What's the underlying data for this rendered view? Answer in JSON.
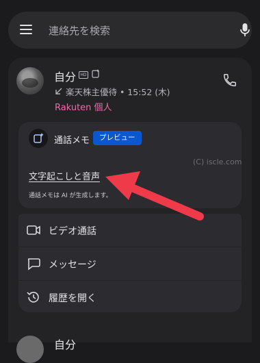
{
  "search": {
    "placeholder": "連絡先を検索"
  },
  "contact": {
    "name": "自分",
    "hd_badge": "HD",
    "call_info": "楽天株主優待 • 15:52 (木)",
    "labels": "Rakuten 個人"
  },
  "memo": {
    "title": "通話メモ",
    "badge": "プレビュー",
    "watermark": "(C) iscle.com",
    "transcript_link": "文字起こしと音声",
    "ai_note": "通話メモは AI が生成します。"
  },
  "actions": [
    {
      "label": "ビデオ通話",
      "icon": "video-icon"
    },
    {
      "label": "メッセージ",
      "icon": "message-icon"
    },
    {
      "label": "履歴を開く",
      "icon": "history-icon"
    }
  ],
  "next_contact": {
    "name": "自分"
  },
  "colors": {
    "background": "#1b1b1d",
    "surface": "#232326",
    "card": "#2c2c30",
    "accent_pink": "#e86ea8",
    "badge_blue": "#0b57d0",
    "annotation_red": "#ef3a4a"
  }
}
